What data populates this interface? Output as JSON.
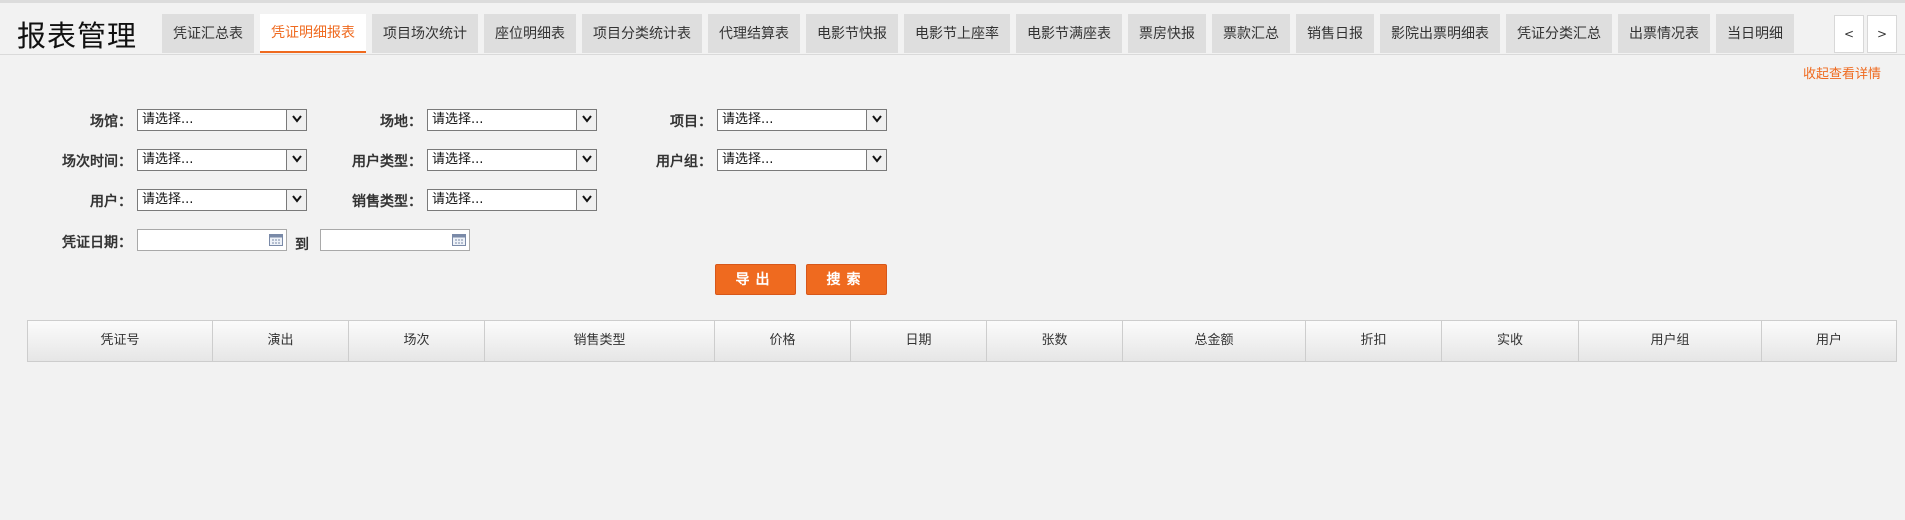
{
  "page_title": "报表管理",
  "tabs": [
    {
      "label": "凭证汇总表",
      "active": false
    },
    {
      "label": "凭证明细报表",
      "active": true
    },
    {
      "label": "项目场次统计",
      "active": false
    },
    {
      "label": "座位明细表",
      "active": false
    },
    {
      "label": "项目分类统计表",
      "active": false
    },
    {
      "label": "代理结算表",
      "active": false
    },
    {
      "label": "电影节快报",
      "active": false
    },
    {
      "label": "电影节上座率",
      "active": false
    },
    {
      "label": "电影节满座表",
      "active": false
    },
    {
      "label": "票房快报",
      "active": false
    },
    {
      "label": "票款汇总",
      "active": false
    },
    {
      "label": "销售日报",
      "active": false
    },
    {
      "label": "影院出票明细表",
      "active": false
    },
    {
      "label": "凭证分类汇总",
      "active": false
    },
    {
      "label": "出票情况表",
      "active": false
    },
    {
      "label": "当日明细",
      "active": false
    }
  ],
  "tab_scroll": {
    "prev": "<",
    "next": ">"
  },
  "collapse_link": "收起查看详情",
  "filters": {
    "venue": {
      "label": "场馆：",
      "value": "请选择..."
    },
    "site": {
      "label": "场地：",
      "value": "请选择..."
    },
    "project": {
      "label": "项目：",
      "value": "请选择..."
    },
    "session_time": {
      "label": "场次时间：",
      "value": "请选择..."
    },
    "user_type": {
      "label": "用户类型：",
      "value": "请选择..."
    },
    "user_group": {
      "label": "用户组：",
      "value": "请选择..."
    },
    "user": {
      "label": "用户：",
      "value": "请选择..."
    },
    "sale_type": {
      "label": "销售类型：",
      "value": "请选择..."
    },
    "voucher_date": {
      "label": "凭证日期：",
      "to": "到",
      "from_value": "",
      "to_value": ""
    }
  },
  "buttons": {
    "export": "导出",
    "search": "搜索"
  },
  "table": {
    "columns": [
      "凭证号",
      "演出",
      "场次",
      "销售类型",
      "价格",
      "日期",
      "张数",
      "总金额",
      "折扣",
      "实收",
      "用户组",
      "用户"
    ],
    "rows": []
  },
  "colors": {
    "accent": "#ef6a1f",
    "background": "#f2f2f2"
  }
}
